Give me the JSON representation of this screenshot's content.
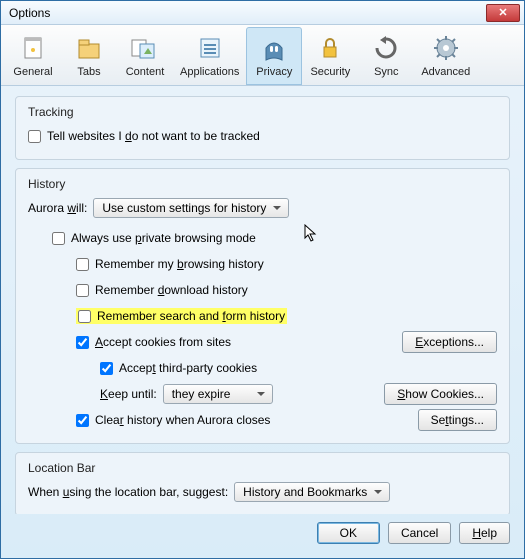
{
  "window": {
    "title": "Options"
  },
  "toolbar": {
    "items": [
      {
        "label": "General"
      },
      {
        "label": "Tabs"
      },
      {
        "label": "Content"
      },
      {
        "label": "Applications"
      },
      {
        "label": "Privacy"
      },
      {
        "label": "Security"
      },
      {
        "label": "Sync"
      },
      {
        "label": "Advanced"
      }
    ]
  },
  "tracking": {
    "title": "Tracking",
    "do_not_track": "Tell websites I do not want to be tracked"
  },
  "history": {
    "title": "History",
    "aurora_will": "Aurora will:",
    "aurora_will_value": "Use custom settings for history",
    "always_private": "Always use private browsing mode",
    "remember_browsing": "Remember my browsing history",
    "remember_download": "Remember download history",
    "remember_search_form": "Remember search and form history",
    "accept_cookies": "Accept cookies from sites",
    "accept_third_party": "Accept third-party cookies",
    "keep_until": "Keep until:",
    "keep_until_value": "they expire",
    "clear_on_close": "Clear history when Aurora closes",
    "buttons": {
      "exceptions": "Exceptions...",
      "show_cookies": "Show Cookies...",
      "settings": "Settings..."
    }
  },
  "location_bar": {
    "title": "Location Bar",
    "suggest_label": "When using the location bar, suggest:",
    "suggest_value": "History and Bookmarks"
  },
  "footer": {
    "ok": "OK",
    "cancel": "Cancel",
    "help": "Help"
  }
}
